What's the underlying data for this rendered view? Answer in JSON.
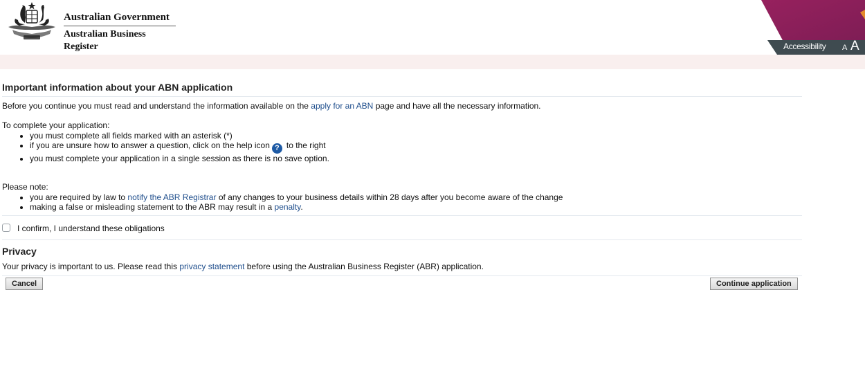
{
  "header": {
    "gov_title": "Australian Government",
    "gov_subtitle": "Australian Business Register",
    "accessibility_label": "Accessibility",
    "font_small_label": "A",
    "font_large_label": "A",
    "brand_color": "#8e1e58",
    "access_bar_color": "#3f4b50"
  },
  "main": {
    "title": "Important information about your ABN application",
    "intro": {
      "before": "Before you continue you must read and understand the information available on the ",
      "link": "apply for an ABN",
      "after": " page and have all the necessary information."
    },
    "complete": {
      "heading": "To complete your application:",
      "items": [
        "you must complete all fields marked with an asterisk (*)",
        "if you are unsure how to answer a question, click on the help icon",
        "to the right",
        "you must complete your application in a single session as there is no save option."
      ],
      "help_icon_glyph": "?"
    },
    "note": {
      "heading": "Please note:",
      "item1_before": "you are required by law to ",
      "item1_link": "notify the ABR Registrar",
      "item1_after": " of any changes to your business details within 28 days after you become aware of the change",
      "item2_before": "making a false or misleading statement to the ABR may result in a ",
      "item2_link": "penalty",
      "item2_after": "."
    },
    "confirm_label": "I confirm, I understand these obligations",
    "confirm_checked": false
  },
  "privacy": {
    "title": "Privacy",
    "before": "Your privacy is important to us. Please read this ",
    "link": "privacy statement",
    "after": " before using the Australian Business Register (ABR) application."
  },
  "actions": {
    "cancel_label": "Cancel",
    "continue_label": "Continue application"
  }
}
